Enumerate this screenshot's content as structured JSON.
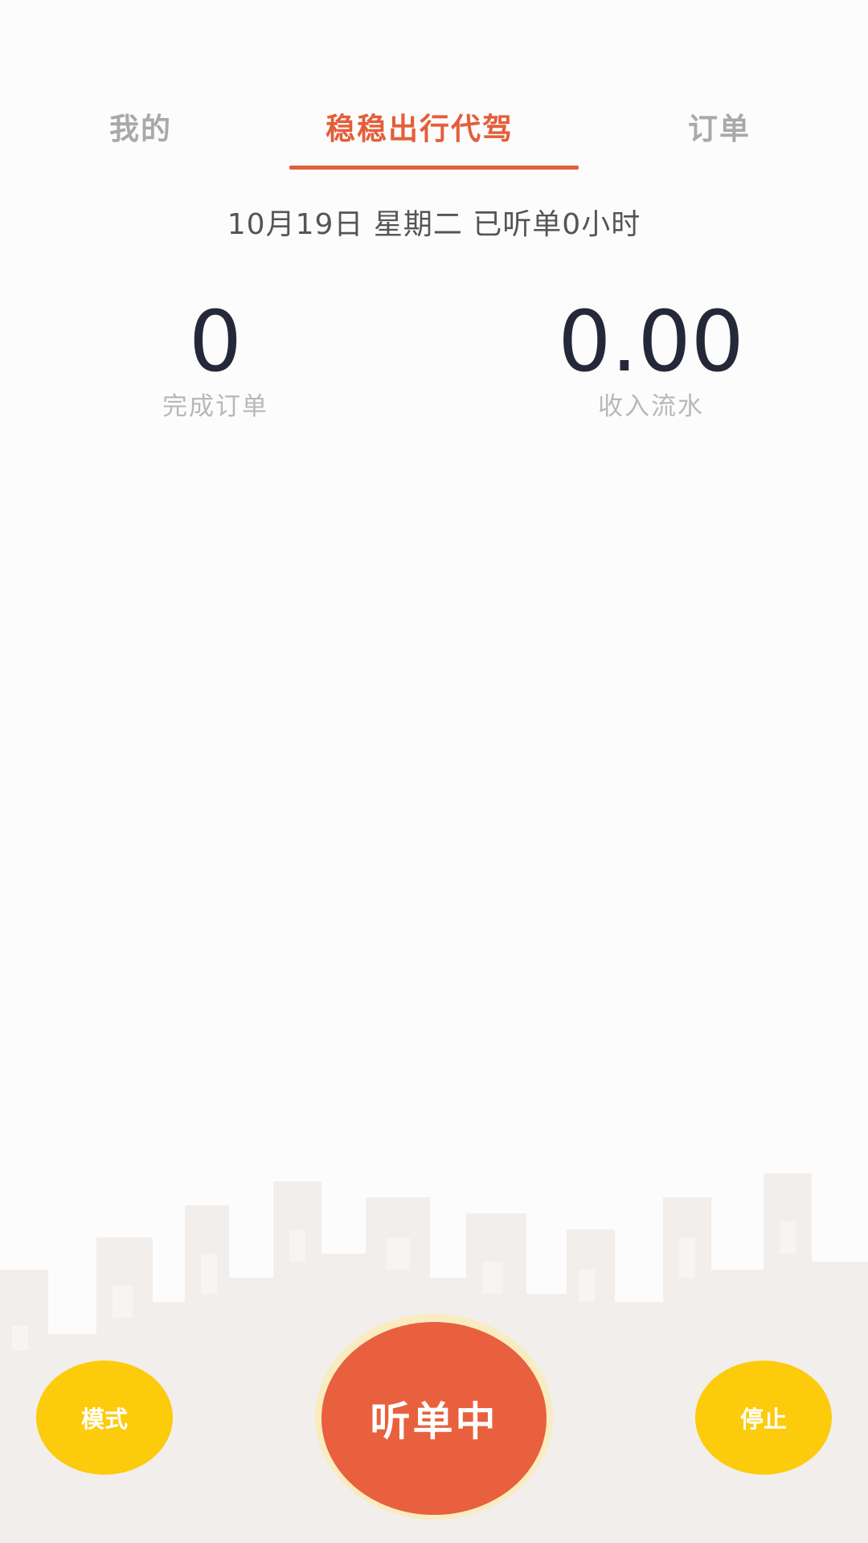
{
  "tabs": {
    "mine": "我的",
    "home": "稳稳出行代驾",
    "orders": "订单",
    "active": "home"
  },
  "status": {
    "date_line": "10月19日 星期二 已听单0小时"
  },
  "stats": {
    "completed_orders_value": "0",
    "completed_orders_label": "完成订单",
    "income_value": "0.00",
    "income_label": "收入流水"
  },
  "actions": {
    "mode_label": "模式",
    "listen_label": "听单中",
    "stop_label": "停止"
  },
  "colors": {
    "accent": "#e45e3a",
    "button_yellow": "#fccb0b",
    "listen_button": "#e8603e",
    "value_text": "#252838"
  }
}
